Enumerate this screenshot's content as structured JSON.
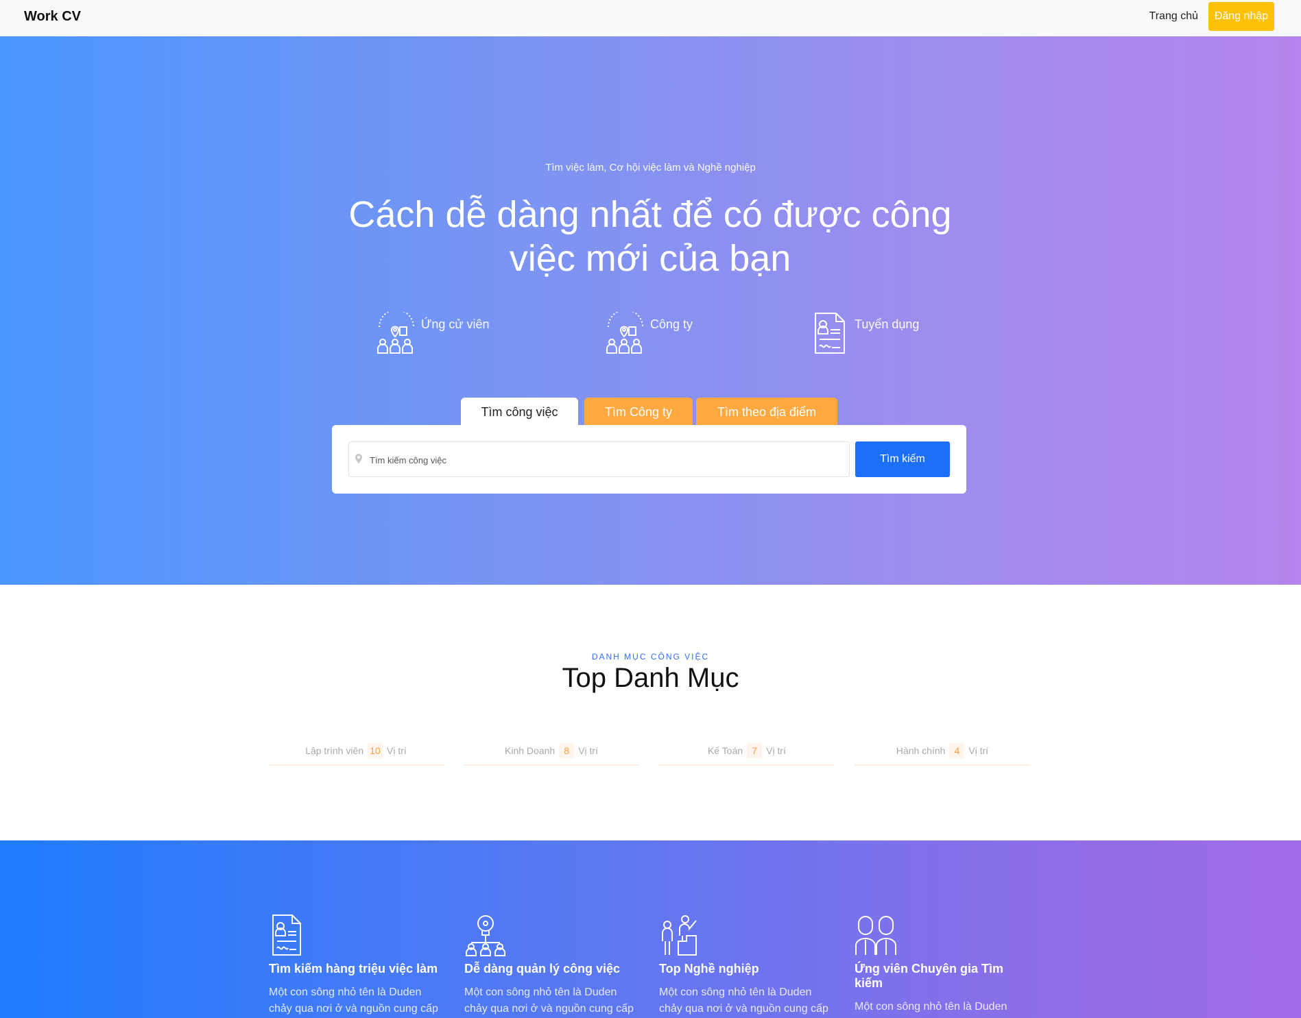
{
  "nav": {
    "brand": "Work CV",
    "home": "Trang chủ",
    "login": "Đăng nhập"
  },
  "hero": {
    "subtitle": "Tìm việc làm, Cơ hội việc làm và Nghề nghiệp",
    "title": "Cách dễ dàng nhất để có được công việc mới của bạn",
    "stats": [
      {
        "label": "Ứng cử viên",
        "icon": "candidates-icon"
      },
      {
        "label": "Công ty",
        "icon": "company-icon"
      },
      {
        "label": "Tuyển dụng",
        "icon": "resume-icon"
      }
    ],
    "tabs": [
      "Tìm công việc",
      "Tìm Công ty",
      "Tìm theo địa điểm"
    ],
    "search": {
      "placeholder": "Tìm kiếm công việc",
      "value": "",
      "button": "Tìm kiếm"
    }
  },
  "categories": {
    "kicker": "DANH MỤC CÔNG VIỆC",
    "title": "Top Danh Mục",
    "items": [
      {
        "name": "Lập trình viên",
        "count": "10",
        "suffix": "Vị trí"
      },
      {
        "name": "Kinh Doanh",
        "count": "8",
        "suffix": "Vị trí"
      },
      {
        "name": "Kế Toán",
        "count": "7",
        "suffix": "Vị trí"
      },
      {
        "name": "Hành chính",
        "count": "4",
        "suffix": "Vị trí"
      }
    ]
  },
  "features": [
    {
      "title": "Tìm kiếm hàng triệu việc làm",
      "desc": "Một con sông nhỏ tên là Duden chảy qua nơi ở và nguồn cung cấp",
      "icon": "resume-icon"
    },
    {
      "title": "Dễ dàng quản lý công việc",
      "desc": "Một con sông nhỏ tên là Duden chảy qua nơi ở và nguồn cung cấp",
      "icon": "idea-network-icon"
    },
    {
      "title": "Top Nghề nghiệp",
      "desc": "Một con sông nhỏ tên là Duden chảy qua nơi ở và nguồn cung cấp",
      "icon": "career-growth-icon"
    },
    {
      "title": "Ứng viên Chuyên gia Tìm kiếm",
      "desc": "Một con sông nhỏ tên là Duden",
      "icon": "experts-icon"
    }
  ],
  "colors": {
    "accent_blue": "#1e6ff7",
    "accent_orange": "#ffa940",
    "login_yellow": "#ffc107"
  }
}
